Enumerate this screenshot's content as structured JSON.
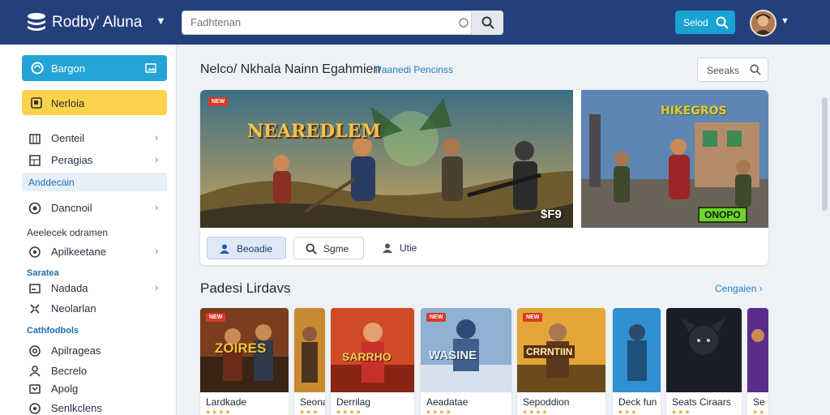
{
  "header": {
    "brand": "Rodby' Aluna",
    "search_placeholder": "Fadhtenan",
    "action_label": "Selod",
    "colors": {
      "bar": "#24407c",
      "accent": "#19a3d2"
    }
  },
  "sidebar": {
    "primary_label": "Bargon",
    "secondary_label": "Nerloia",
    "items_top": [
      {
        "label": "Oenteil",
        "icon": "building-icon"
      },
      {
        "label": "Peragias",
        "icon": "grid-icon"
      }
    ],
    "active_label": "Anddecain",
    "item_mid": {
      "label": "Dancnoil",
      "icon": "target-icon"
    },
    "section_plain": "Aeelecek odramen",
    "item_mid2": {
      "label": "Apilkeetane",
      "icon": "radio-icon"
    },
    "section_1": "Saratea",
    "items_sec1": [
      {
        "label": "Nadada",
        "icon": "window-icon"
      },
      {
        "label": "Neolarlan",
        "icon": "cross-icon"
      }
    ],
    "section_2": "Cathfodbols",
    "items_sec2": [
      {
        "label": "Apilrageas",
        "icon": "at-icon"
      },
      {
        "label": "Becrelo",
        "icon": "user-icon"
      },
      {
        "label": "Apolg",
        "icon": "box-icon"
      },
      {
        "label": "Senlkclens",
        "icon": "circle-icon"
      }
    ]
  },
  "main": {
    "title": "Nelco/ Nkhala Nainn Egahmien",
    "link": "Paanedi Pencinss",
    "search_label": "Seeaks",
    "hero_main_title": "NEAREDLEM",
    "hero_main_badge": "NEW",
    "hero_main_price": "$F9",
    "hero_side_title": "HIKEGROS",
    "hero_side_tag": "ONOPO",
    "tabs": [
      {
        "label": "Beoadie",
        "icon": "person-icon"
      },
      {
        "label": "Sgme",
        "icon": "search-icon"
      },
      {
        "label": "Utie",
        "icon": "person-outline-icon"
      }
    ],
    "section_title": "Padesi Lirdavs",
    "section_link": "Cengaien",
    "games": [
      {
        "name": "Lardkade",
        "art_title": "ZOIRES",
        "rating": "★★★★"
      },
      {
        "name": "Seona",
        "art_title": "",
        "rating": "★★★"
      },
      {
        "name": "Derrilag",
        "art_title": "SARRHO",
        "rating": "★★★★"
      },
      {
        "name": "Aeadatae",
        "art_title": "WASINE",
        "rating": "★★★★"
      },
      {
        "name": "Sepoddion",
        "art_title": "CRRNTIIN",
        "rating": "★★★★"
      },
      {
        "name": "Deck fun",
        "art_title": "",
        "rating": "★★★"
      },
      {
        "name": "Seats Ciraars",
        "art_title": "",
        "rating": "★★★"
      },
      {
        "name": "Se",
        "art_title": "",
        "rating": "★★"
      }
    ]
  }
}
